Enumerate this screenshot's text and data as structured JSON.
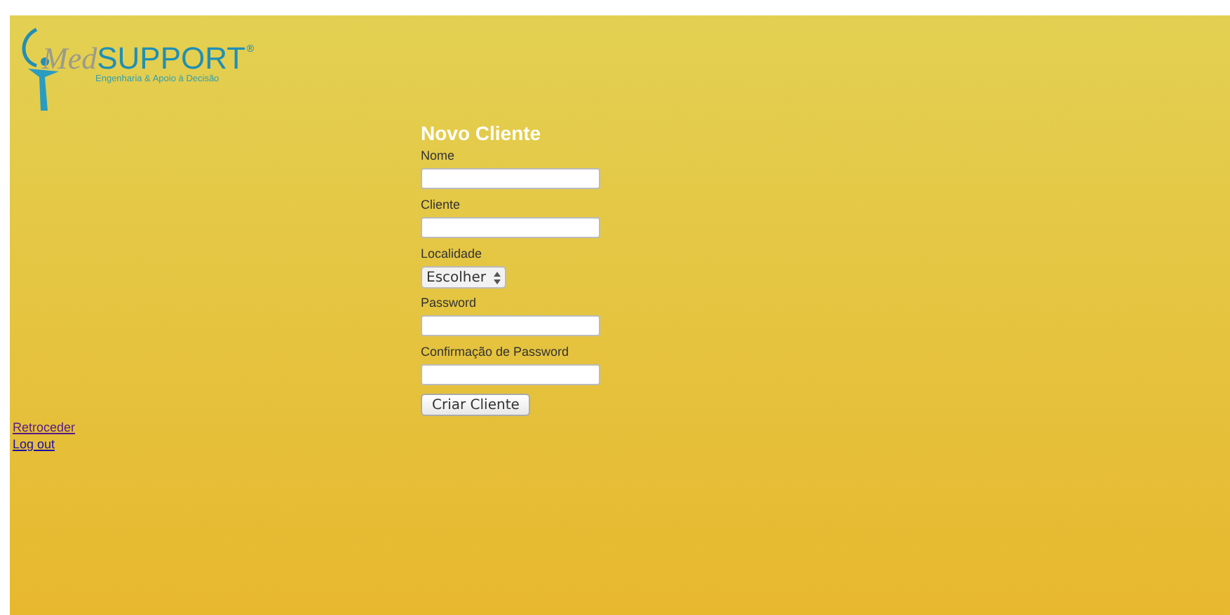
{
  "logo": {
    "name_italic": "Med",
    "name_bold": "SUPPORT",
    "registered": "®",
    "tagline": "Engenharia & Apoio à Decisão"
  },
  "form": {
    "title": "Novo Cliente",
    "fields": [
      {
        "label": "Nome",
        "kind": "text"
      },
      {
        "label": "Cliente",
        "kind": "text"
      },
      {
        "label": "Localidade",
        "kind": "select",
        "value": "Escolher"
      },
      {
        "label": "Password",
        "kind": "password"
      },
      {
        "label": "Confirmação de Password",
        "kind": "password"
      }
    ],
    "submit": "Criar Cliente"
  },
  "links": [
    {
      "label": "Retroceder",
      "visited": true
    },
    {
      "label": "Log out",
      "visited": false
    }
  ]
}
